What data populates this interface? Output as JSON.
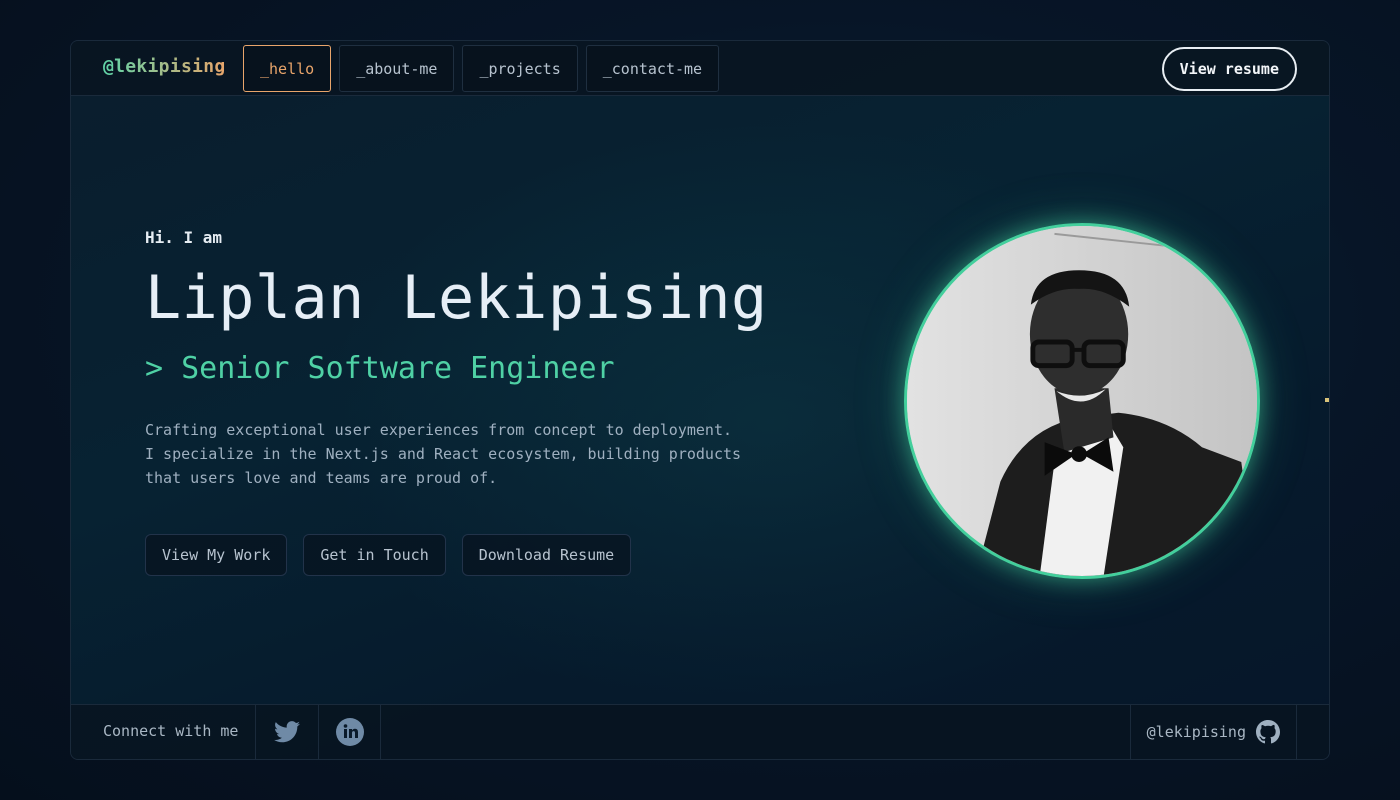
{
  "header": {
    "logo": "@lekipising",
    "tabs": [
      {
        "label": "_hello",
        "active": true
      },
      {
        "label": "_about-me",
        "active": false
      },
      {
        "label": "_projects",
        "active": false
      },
      {
        "label": "_contact-me",
        "active": false
      }
    ],
    "resume_button": "View resume"
  },
  "hero": {
    "greeting": "Hi. I am",
    "name": "Liplan Lekipising",
    "role": "> Senior Software Engineer",
    "description": [
      "Crafting exceptional user experiences from concept to deployment.",
      "I specialize in the Next.js and React ecosystem, building products",
      "that users love and teams are proud of."
    ],
    "buttons": {
      "work": "View My Work",
      "touch": "Get in Touch",
      "download": "Download Resume"
    }
  },
  "avatar": {
    "icon": "profile-photo"
  },
  "footer": {
    "connect_label": "Connect with me",
    "social_icons": [
      "twitter-icon",
      "linkedin-icon"
    ],
    "github_handle": "@lekipising",
    "github_icon": "github-icon"
  },
  "colors": {
    "accent_green": "#4fd1a5",
    "accent_orange": "#e9a56b",
    "background": "#061221"
  }
}
